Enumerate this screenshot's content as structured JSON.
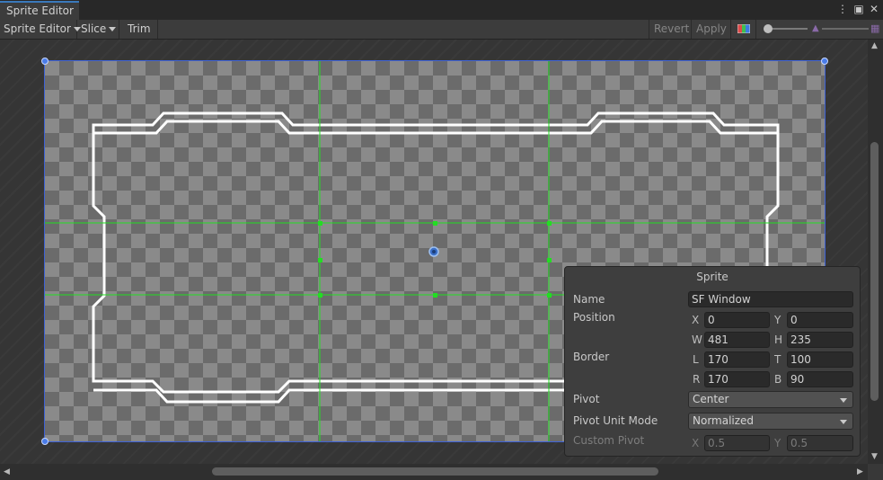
{
  "window": {
    "tab_title": "Sprite Editor"
  },
  "toolbar": {
    "mode_label": "Sprite Editor",
    "slice_label": "Slice",
    "trim_label": "Trim",
    "revert_label": "Revert",
    "apply_label": "Apply",
    "zoom_level": 0.0
  },
  "sprite_panel": {
    "title": "Sprite",
    "name_label": "Name",
    "name_value": "SF Window",
    "position_label": "Position",
    "x_label": "X",
    "x_value": "0",
    "y_label": "Y",
    "y_value": "0",
    "w_label": "W",
    "w_value": "481",
    "h_label": "H",
    "h_value": "235",
    "border_label": "Border",
    "l_label": "L",
    "l_value": "170",
    "t_label": "T",
    "t_value": "100",
    "r_label": "R",
    "r_value": "170",
    "b_label": "B",
    "b_value": "90",
    "pivot_label": "Pivot",
    "pivot_value": "Center",
    "pivot_unit_label": "Pivot Unit Mode",
    "pivot_unit_value": "Normalized",
    "custom_pivot_label": "Custom Pivot",
    "cp_x_label": "X",
    "cp_x_value": "0.5",
    "cp_y_label": "Y",
    "cp_y_value": "0.5"
  },
  "colors": {
    "accent": "#3a79bb",
    "border_guides": "#22dd22",
    "sprite_rect": "#3f63d6"
  }
}
